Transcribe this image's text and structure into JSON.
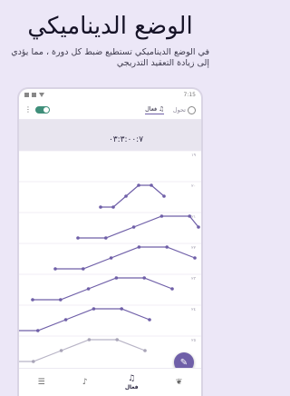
{
  "promo": {
    "title": "الوضع الديناميكي",
    "description": "في الوضع الديناميكي تستطيع ضبط كل دورة ، مما يؤدي إلى زيادة التعقيد التدريجي"
  },
  "status_bar": {
    "time": "7:15"
  },
  "app_bar": {
    "tabs": [
      {
        "label": "تحول",
        "active": false
      },
      {
        "label": "فعال",
        "active": true
      }
    ]
  },
  "total_time": "٠٣:٣:٠٠:٧",
  "accent_color": "#6f5fa8",
  "chart_data": {
    "type": "line",
    "rows": [
      {
        "index": "١٩",
        "points": []
      },
      {
        "index": "٢٠",
        "points": [
          [
            1,
            1
          ],
          [
            2,
            1
          ],
          [
            3,
            2
          ],
          [
            4,
            3
          ],
          [
            5,
            3
          ],
          [
            6,
            2
          ]
        ]
      },
      {
        "index": "٢١",
        "points": [
          [
            1,
            1
          ],
          [
            2,
            1
          ],
          [
            3,
            2
          ],
          [
            4,
            3
          ],
          [
            5,
            3
          ],
          [
            6,
            2
          ]
        ]
      },
      {
        "index": "٢٢",
        "points": [
          [
            1,
            1
          ],
          [
            2,
            1
          ],
          [
            3,
            2
          ],
          [
            4,
            3
          ],
          [
            5,
            3
          ],
          [
            6,
            2
          ]
        ]
      },
      {
        "index": "٢٣",
        "points": [
          [
            1,
            1
          ],
          [
            2,
            1
          ],
          [
            3,
            2
          ],
          [
            4,
            3
          ],
          [
            5,
            3
          ],
          [
            6,
            2
          ]
        ]
      },
      {
        "index": "٢٤",
        "points": [
          [
            1,
            1
          ],
          [
            2,
            1
          ],
          [
            3,
            2
          ],
          [
            4,
            3
          ],
          [
            5,
            3
          ],
          [
            6,
            2
          ]
        ]
      },
      {
        "index": "٢٥",
        "points": [
          [
            1,
            1
          ],
          [
            2,
            1
          ],
          [
            3,
            2
          ],
          [
            4,
            3
          ],
          [
            5,
            3
          ],
          [
            6,
            2
          ]
        ]
      }
    ]
  },
  "bottom_nav": [
    {
      "label": "",
      "icon": "sliders-icon"
    },
    {
      "label": "",
      "icon": "bell-icon"
    },
    {
      "label": "فعال",
      "icon": "music-note-icon",
      "active": true
    },
    {
      "label": "",
      "icon": "lungs-icon"
    }
  ]
}
